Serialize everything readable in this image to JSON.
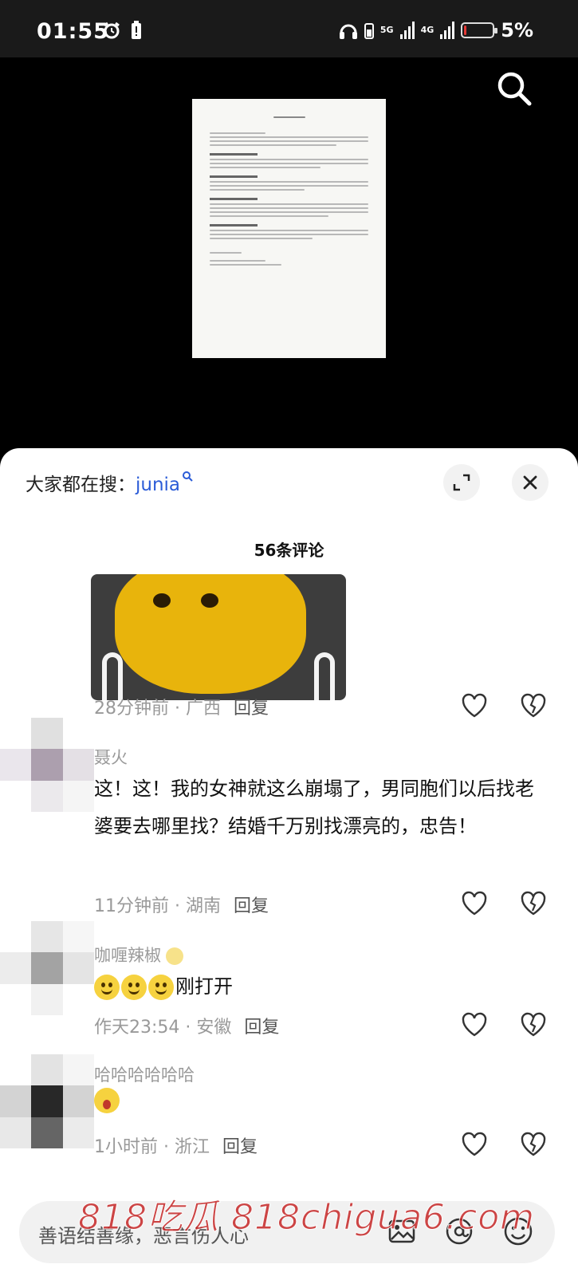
{
  "status_bar": {
    "time": "01:55",
    "network_1": "5G",
    "network_2": "4G",
    "battery": "5%",
    "battery_level": 0.05,
    "battery_color": "#e53935"
  },
  "search_button": {
    "icon": "search-icon"
  },
  "trending": {
    "label": "大家都在搜：",
    "term": "junia",
    "term_color": "#2a5bd7"
  },
  "comments_title": "56条评论",
  "comments": [
    {
      "meta": "28分钟前 · 广西",
      "reply": "回复",
      "has_sticker": true
    },
    {
      "username": "聂火",
      "text": "这！这！我的女神就这么崩塌了，男同胞们以后找老婆要去哪里找？结婚千万别找漂亮的，忠告！",
      "meta": "11分钟前 · 湖南",
      "reply": "回复"
    },
    {
      "username": "咖喱辣椒",
      "text": "刚打开",
      "meta": "作天23:54 · 安徽",
      "reply": "回复"
    },
    {
      "username": "哈哈哈哈哈哈",
      "text": "",
      "meta": "1小时前 · 浙江",
      "reply": "回复"
    }
  ],
  "input_bar": {
    "placeholder": "善语结善缘，恶言伤人心"
  },
  "watermark": "818吃瓜 818chigua6.com"
}
